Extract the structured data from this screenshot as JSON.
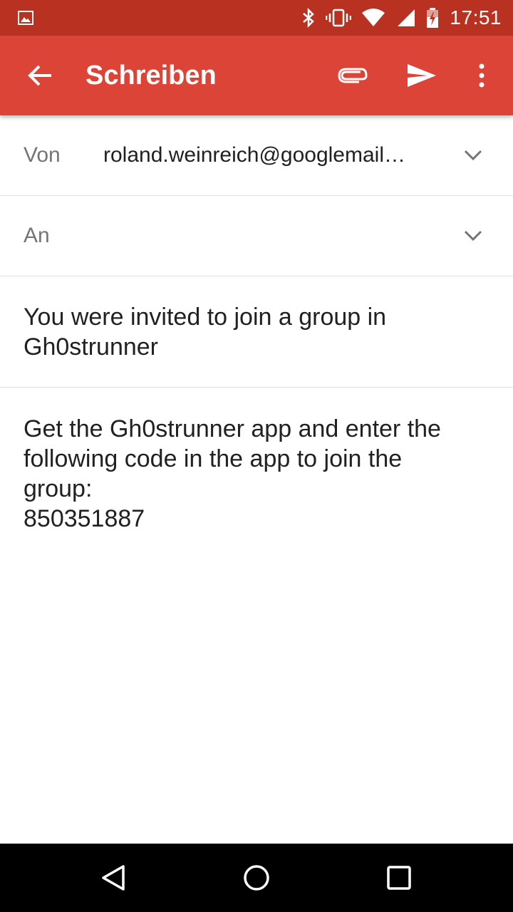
{
  "status_bar": {
    "time": "17:51",
    "icons": [
      "image-notification-icon",
      "bluetooth-icon",
      "vibrate-icon",
      "wifi-icon",
      "signal-icon",
      "battery-charging-icon"
    ]
  },
  "app_bar": {
    "title": "Schreiben",
    "icons": [
      "back-arrow-icon",
      "paperclip-icon",
      "send-icon",
      "more-vert-icon"
    ]
  },
  "compose": {
    "from_label": "Von",
    "from_value": "roland.weinreich@googlemail…",
    "to_label": "An",
    "to_value": "",
    "subject": "You were invited to join a group in Gh0strunner",
    "body_lines": [
      "Get the Gh0strunner app and enter the",
      "following code in the app to join the",
      "group:",
      "850351887"
    ]
  },
  "nav_bar": {
    "icons": [
      "nav-back-icon",
      "nav-home-icon",
      "nav-recents-icon"
    ]
  },
  "colors": {
    "status_bar": "#b93221",
    "app_bar": "#db4437",
    "text_primary": "#212121",
    "text_secondary": "#757575"
  }
}
